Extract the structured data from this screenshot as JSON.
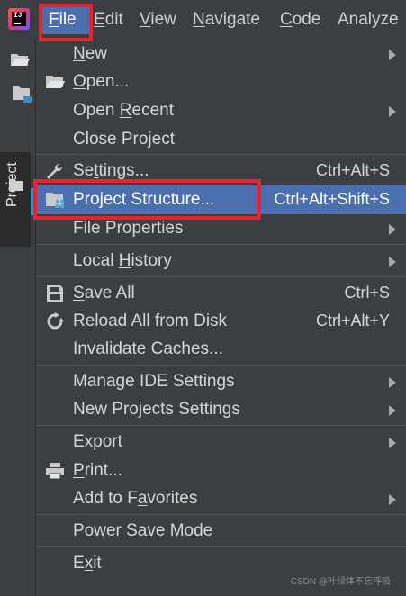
{
  "menubar": {
    "items": [
      {
        "label": "File",
        "mnemonic": "F",
        "rest": "ile"
      },
      {
        "label": "Edit",
        "mnemonic": "E",
        "rest": "dit"
      },
      {
        "label": "View",
        "mnemonic": "V",
        "rest": "iew"
      },
      {
        "label": "Navigate",
        "mnemonic": "N",
        "rest": "avigate"
      },
      {
        "label": "Code",
        "mnemonic": "C",
        "rest": "ode"
      },
      {
        "label": "Analyze",
        "mnemonic": "",
        "rest": "Analyze"
      }
    ],
    "logo_text": "IJ"
  },
  "left_strip": {
    "project_tab_label": "Project"
  },
  "file_menu": {
    "new": {
      "pre": "",
      "mn": "N",
      "post": "ew"
    },
    "open": {
      "pre": "",
      "mn": "O",
      "post": "pen..."
    },
    "open_recent": {
      "pre": "Open ",
      "mn": "R",
      "post": "ecent"
    },
    "close_project": {
      "label": "Close Project"
    },
    "settings": {
      "pre": "Se",
      "mn": "t",
      "post": "tings...",
      "shortcut": "Ctrl+Alt+S"
    },
    "project_structure": {
      "label": "Project Structure...",
      "shortcut": "Ctrl+Alt+Shift+S"
    },
    "file_properties": {
      "label": "File Properties"
    },
    "local_history": {
      "pre": "Local ",
      "mn": "H",
      "post": "istory"
    },
    "save_all": {
      "pre": "",
      "mn": "S",
      "post": "ave All",
      "shortcut": "Ctrl+S"
    },
    "reload_all": {
      "label": "Reload All from Disk",
      "shortcut": "Ctrl+Alt+Y"
    },
    "invalidate_caches": {
      "label": "Invalidate Caches..."
    },
    "manage_ide_settings": {
      "label": "Manage IDE Settings"
    },
    "new_projects_settings": {
      "label": "New Projects Settings"
    },
    "export": {
      "label": "Export"
    },
    "print": {
      "pre": "",
      "mn": "P",
      "post": "rint..."
    },
    "add_to_favorites": {
      "pre": "Add to F",
      "mn": "a",
      "post": "vorites"
    },
    "power_save_mode": {
      "label": "Power Save Mode"
    },
    "exit": {
      "pre": "E",
      "mn": "x",
      "post": "it"
    }
  },
  "watermark": "CSDN @叶绿体不忘呼吸",
  "colors": {
    "background": "#3c3f41",
    "selection": "#4b6eaf",
    "highlight_box": "#e8232b",
    "text": "#d6d6d6"
  }
}
